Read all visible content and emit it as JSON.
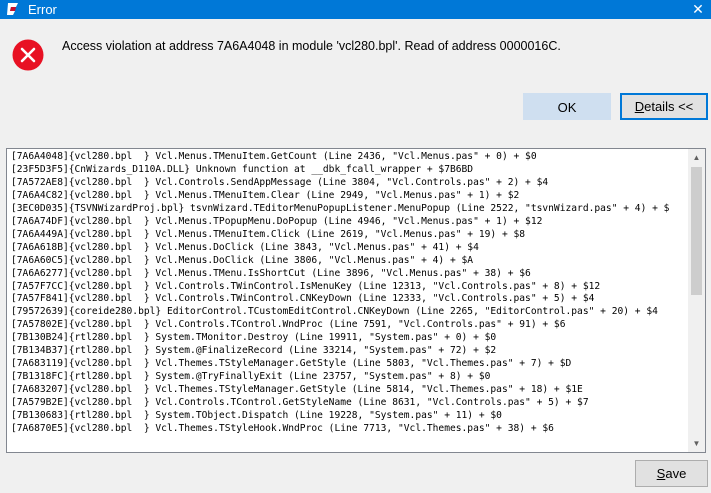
{
  "window": {
    "title": "Error",
    "close_glyph": "✕",
    "app_icon": "delphi-app-icon"
  },
  "dialog": {
    "icon": "error-icon",
    "message": "Access violation at address 7A6A4048 in module 'vcl280.bpl'. Read of address 0000016C.",
    "ok_label": "OK",
    "details_label": "Details <<",
    "details_mnemonic": "D",
    "details_rest": "etails <<",
    "save_label": "Save",
    "save_mnemonic": "S",
    "save_rest": "ave"
  },
  "log": {
    "lines": [
      "[7A6A4048]{vcl280.bpl  } Vcl.Menus.TMenuItem.GetCount (Line 2436, \"Vcl.Menus.pas\" + 0) + $0",
      "[23F5D3F5]{CnWizards_D110A.DLL} Unknown function at __dbk_fcall_wrapper + $7B6BD",
      "[7A572AE8]{vcl280.bpl  } Vcl.Controls.SendAppMessage (Line 3804, \"Vcl.Controls.pas\" + 2) + $4",
      "[7A6A4C82]{vcl280.bpl  } Vcl.Menus.TMenuItem.Clear (Line 2949, \"Vcl.Menus.pas\" + 1) + $2",
      "[3EC0D035]{TSVNWizardProj.bpl} tsvnWizard.TEditorMenuPopupListener.MenuPopup (Line 2522, \"tsvnWizard.pas\" + 4) + $",
      "[7A6A74DF]{vcl280.bpl  } Vcl.Menus.TPopupMenu.DoPopup (Line 4946, \"Vcl.Menus.pas\" + 1) + $12",
      "[7A6A449A]{vcl280.bpl  } Vcl.Menus.TMenuItem.Click (Line 2619, \"Vcl.Menus.pas\" + 19) + $8",
      "[7A6A618B]{vcl280.bpl  } Vcl.Menus.DoClick (Line 3843, \"Vcl.Menus.pas\" + 41) + $4",
      "[7A6A60C5]{vcl280.bpl  } Vcl.Menus.DoClick (Line 3806, \"Vcl.Menus.pas\" + 4) + $A",
      "[7A6A6277]{vcl280.bpl  } Vcl.Menus.TMenu.IsShortCut (Line 3896, \"Vcl.Menus.pas\" + 38) + $6",
      "[7A57F7CC]{vcl280.bpl  } Vcl.Controls.TWinControl.IsMenuKey (Line 12313, \"Vcl.Controls.pas\" + 8) + $12",
      "[7A57F841]{vcl280.bpl  } Vcl.Controls.TWinControl.CNKeyDown (Line 12333, \"Vcl.Controls.pas\" + 5) + $4",
      "[79572639]{coreide280.bpl} EditorControl.TCustomEditControl.CNKeyDown (Line 2265, \"EditorControl.pas\" + 20) + $4",
      "[7A57802E]{vcl280.bpl  } Vcl.Controls.TControl.WndProc (Line 7591, \"Vcl.Controls.pas\" + 91) + $6",
      "[7B130B24]{rtl280.bpl  } System.TMonitor.Destroy (Line 19911, \"System.pas\" + 0) + $0",
      "[7B134B37]{rtl280.bpl  } System.@FinalizeRecord (Line 33214, \"System.pas\" + 72) + $2",
      "[7A683119]{vcl280.bpl  } Vcl.Themes.TStyleManager.GetStyle (Line 5803, \"Vcl.Themes.pas\" + 7) + $D",
      "[7B1318FC]{rtl280.bpl  } System.@TryFinallyExit (Line 23757, \"System.pas\" + 8) + $0",
      "[7A683207]{vcl280.bpl  } Vcl.Themes.TStyleManager.GetStyle (Line 5814, \"Vcl.Themes.pas\" + 18) + $1E",
      "[7A579B2E]{vcl280.bpl  } Vcl.Controls.TControl.GetStyleName (Line 8631, \"Vcl.Controls.pas\" + 5) + $7",
      "[7B130683]{rtl280.bpl  } System.TObject.Dispatch (Line 19228, \"System.pas\" + 11) + $0",
      "[7A6870E5]{vcl280.bpl  } Vcl.Themes.TStyleHook.WndProc (Line 7713, \"Vcl.Themes.pas\" + 38) + $6"
    ]
  },
  "colors": {
    "titlebar": "#0078d7",
    "error_red": "#e81123",
    "ok_button": "#cfdff0",
    "focus_border": "#0078d7"
  }
}
